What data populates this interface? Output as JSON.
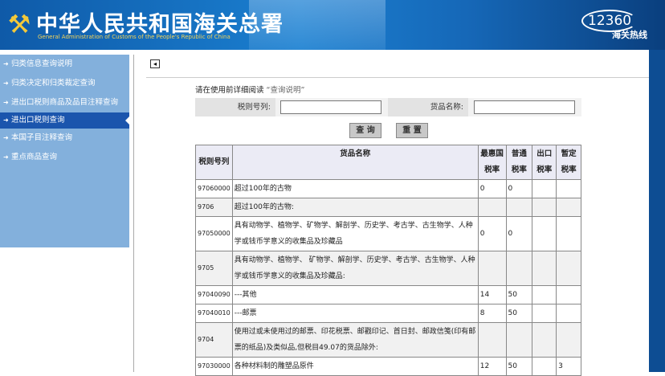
{
  "header": {
    "title": "中华人民共和国海关总署",
    "subtitle": "General Administration of Customs of the People's Republic of China",
    "hotline_number": "12360",
    "hotline_label": "海关热线"
  },
  "sidebar": {
    "items": [
      {
        "label": "归类信息查询说明",
        "active": false
      },
      {
        "label": "归类决定和归类裁定查询",
        "active": false
      },
      {
        "label": "进出口税则商品及品目注释查询",
        "active": false
      },
      {
        "label": "进出口税则查询",
        "active": true
      },
      {
        "label": "本国子目注释查询",
        "active": false
      },
      {
        "label": "重点商品查询",
        "active": false
      }
    ]
  },
  "main": {
    "notice_prefix": "请在使用前详细阅读",
    "notice_link": "“查询说明”",
    "form": {
      "tariff_label": "税则号列:",
      "tariff_value": "",
      "goods_label": "货品名称:",
      "goods_value": ""
    },
    "buttons": {
      "query": "查 询",
      "reset": "重 置"
    },
    "table": {
      "headers": [
        "税则号列",
        "货品名称",
        "最惠国税率",
        "普通税率",
        "出口税率",
        "暂定税率"
      ],
      "rows": [
        [
          "97060000",
          "超过100年的古物",
          "0",
          "0",
          "",
          ""
        ],
        [
          "9706",
          "超过100年的古物:",
          "",
          "",
          "",
          ""
        ],
        [
          "97050000",
          "具有动物学、植物学、矿物学、解剖学、历史学、考古学、古生物学、人种学或钱币学意义的收集品及珍藏品",
          "0",
          "0",
          "",
          ""
        ],
        [
          "9705",
          "具有动物学、植物学、 矿物学、解剖学、历史学、考古学、古生物学、人种学或钱币学意义的收集品及珍藏品:",
          "",
          "",
          "",
          ""
        ],
        [
          "97040090",
          "---其他",
          "14",
          "50",
          "",
          ""
        ],
        [
          "97040010",
          "---邮票",
          "8",
          "50",
          "",
          ""
        ],
        [
          "9704",
          "使用过或未使用过的邮票、印花税票、邮戳印记、首日封、邮政信笺(印有邮票的纸品)及类似品,但税目49.07的货品除外:",
          "",
          "",
          "",
          ""
        ],
        [
          "97030000",
          "各种材料制的雕塑品原件",
          "12",
          "50",
          "",
          "3"
        ]
      ]
    }
  }
}
